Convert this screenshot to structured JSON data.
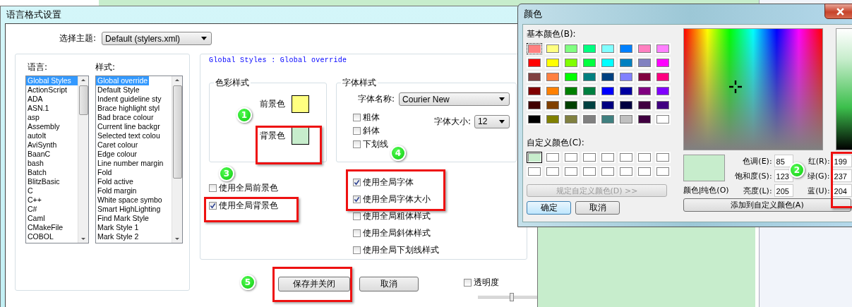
{
  "main_dialog": {
    "title": "语言格式设置",
    "theme": {
      "label": "选择主题:",
      "value": "Default (stylers.xml)"
    },
    "languages": {
      "label": "语言:",
      "items": [
        {
          "text": "Global Styles",
          "selected": true
        },
        {
          "text": "ActionScript",
          "selected": false
        },
        {
          "text": "ADA",
          "selected": false
        },
        {
          "text": "ASN.1",
          "selected": false
        },
        {
          "text": "asp",
          "selected": false
        },
        {
          "text": "Assembly",
          "selected": false
        },
        {
          "text": "autoIt",
          "selected": false
        },
        {
          "text": "AviSynth",
          "selected": false
        },
        {
          "text": "BaanC",
          "selected": false
        },
        {
          "text": "bash",
          "selected": false
        },
        {
          "text": "Batch",
          "selected": false
        },
        {
          "text": "BlitzBasic",
          "selected": false
        },
        {
          "text": "C",
          "selected": false
        },
        {
          "text": "C++",
          "selected": false
        },
        {
          "text": "C#",
          "selected": false
        },
        {
          "text": "Caml",
          "selected": false
        },
        {
          "text": "CMakeFile",
          "selected": false
        },
        {
          "text": "COBOL",
          "selected": false
        }
      ]
    },
    "styles": {
      "label": "样式:",
      "items": [
        {
          "text": "Global override",
          "selected": true
        },
        {
          "text": "Default Style",
          "selected": false
        },
        {
          "text": "Indent guideline sty",
          "selected": false
        },
        {
          "text": "Brace highlight styl",
          "selected": false
        },
        {
          "text": "Bad brace colour",
          "selected": false
        },
        {
          "text": "Current line backgr",
          "selected": false
        },
        {
          "text": "Selected text colou",
          "selected": false
        },
        {
          "text": "Caret colour",
          "selected": false
        },
        {
          "text": "Edge colour",
          "selected": false
        },
        {
          "text": "Line number margin",
          "selected": false
        },
        {
          "text": "Fold",
          "selected": false
        },
        {
          "text": "Fold active",
          "selected": false
        },
        {
          "text": "Fold margin",
          "selected": false
        },
        {
          "text": "White space symbo",
          "selected": false
        },
        {
          "text": "Smart HighLighting",
          "selected": false
        },
        {
          "text": "Find Mark Style",
          "selected": false
        },
        {
          "text": "Mark Style 1",
          "selected": false
        },
        {
          "text": "Mark Style 2",
          "selected": false
        }
      ]
    },
    "style_heading": "Global Styles : Global override",
    "color_style": {
      "title": "色彩样式",
      "swatches": [
        {
          "label": "前景色",
          "color": "#ffff80"
        },
        {
          "label": "背景色",
          "color": "#c7edcc"
        }
      ]
    },
    "font_style": {
      "title": "字体样式",
      "font_name": {
        "label": "字体名称:",
        "value": "Courier New"
      },
      "options": [
        {
          "label": "粗体",
          "checked": false
        },
        {
          "label": "斜体",
          "checked": false
        },
        {
          "label": "下划线",
          "checked": false
        }
      ],
      "font_size": {
        "label": "字体大小:",
        "value": "12"
      }
    },
    "global_color_options": [
      {
        "label": "使用全局前景色",
        "checked": false
      },
      {
        "label": "使用全局背景色",
        "checked": true
      }
    ],
    "global_font_options": [
      {
        "label": "使用全局字体",
        "checked": true
      },
      {
        "label": "使用全局字体大小",
        "checked": true
      },
      {
        "label": "使用全局粗体样式",
        "checked": false
      },
      {
        "label": "使用全局斜体样式",
        "checked": false
      },
      {
        "label": "使用全局下划线样式",
        "checked": false
      }
    ],
    "buttons": [
      {
        "label": "保存并关闭"
      },
      {
        "label": "取消"
      }
    ],
    "transparency": {
      "label": "透明度",
      "checked": false,
      "level": 0.57
    }
  },
  "color_dialog": {
    "title": "颜色",
    "basic_colors_label": "基本颜色(B):",
    "basic_colors": [
      {
        "color": "#ff8080",
        "selected": true
      },
      {
        "color": "#ffff80",
        "selected": false
      },
      {
        "color": "#80ff80",
        "selected": false
      },
      {
        "color": "#00ff80",
        "selected": false
      },
      {
        "color": "#80ffff",
        "selected": false
      },
      {
        "color": "#0080ff",
        "selected": false
      },
      {
        "color": "#ff80c0",
        "selected": false
      },
      {
        "color": "#ff80ff",
        "selected": false
      },
      {
        "color": "#ff0000",
        "selected": false
      },
      {
        "color": "#ffff00",
        "selected": false
      },
      {
        "color": "#80ff00",
        "selected": false
      },
      {
        "color": "#00ff40",
        "selected": false
      },
      {
        "color": "#00ffff",
        "selected": false
      },
      {
        "color": "#0080c0",
        "selected": false
      },
      {
        "color": "#8080c0",
        "selected": false
      },
      {
        "color": "#ff00ff",
        "selected": false
      },
      {
        "color": "#804040",
        "selected": false
      },
      {
        "color": "#ff8040",
        "selected": false
      },
      {
        "color": "#00ff00",
        "selected": false
      },
      {
        "color": "#008080",
        "selected": false
      },
      {
        "color": "#004080",
        "selected": false
      },
      {
        "color": "#8080ff",
        "selected": false
      },
      {
        "color": "#800040",
        "selected": false
      },
      {
        "color": "#ff0080",
        "selected": false
      },
      {
        "color": "#800000",
        "selected": false
      },
      {
        "color": "#ff8000",
        "selected": false
      },
      {
        "color": "#008000",
        "selected": false
      },
      {
        "color": "#008040",
        "selected": false
      },
      {
        "color": "#0000ff",
        "selected": false
      },
      {
        "color": "#0000a0",
        "selected": false
      },
      {
        "color": "#800080",
        "selected": false
      },
      {
        "color": "#8000ff",
        "selected": false
      },
      {
        "color": "#400000",
        "selected": false
      },
      {
        "color": "#804000",
        "selected": false
      },
      {
        "color": "#004000",
        "selected": false
      },
      {
        "color": "#004040",
        "selected": false
      },
      {
        "color": "#000080",
        "selected": false
      },
      {
        "color": "#000040",
        "selected": false
      },
      {
        "color": "#400040",
        "selected": false
      },
      {
        "color": "#400080",
        "selected": false
      },
      {
        "color": "#000000",
        "selected": false
      },
      {
        "color": "#808000",
        "selected": false
      },
      {
        "color": "#808040",
        "selected": false
      },
      {
        "color": "#808080",
        "selected": false
      },
      {
        "color": "#408080",
        "selected": false
      },
      {
        "color": "#c0c0c0",
        "selected": false
      },
      {
        "color": "#400040",
        "selected": false
      },
      {
        "color": "#ffffff",
        "selected": false
      }
    ],
    "custom_colors_label": "自定义颜色(C):",
    "custom_colors": [
      {
        "color": "#c7edcc",
        "selected": true
      },
      {
        "color": "#ffffff",
        "selected": false
      },
      {
        "color": "#ffffff",
        "selected": false
      },
      {
        "color": "#ffffff",
        "selected": false
      },
      {
        "color": "#ffffff",
        "selected": false
      },
      {
        "color": "#ffffff",
        "selected": false
      },
      {
        "color": "#ffffff",
        "selected": false
      },
      {
        "color": "#ffffff",
        "selected": false
      },
      {
        "color": "#ffffff",
        "selected": false
      },
      {
        "color": "#ffffff",
        "selected": false
      },
      {
        "color": "#ffffff",
        "selected": false
      },
      {
        "color": "#ffffff",
        "selected": false
      },
      {
        "color": "#ffffff",
        "selected": false
      },
      {
        "color": "#ffffff",
        "selected": false
      },
      {
        "color": "#ffffff",
        "selected": false
      },
      {
        "color": "#ffffff",
        "selected": false
      }
    ],
    "define_button": {
      "label": "规定自定义颜色(D) >>",
      "disabled": true
    },
    "ok_button": "确定",
    "cancel_button": "取消",
    "preview": {
      "label": "颜色|纯色(O)",
      "color": "#c7edcc"
    },
    "hsl_fields": [
      {
        "label": "色调(E):",
        "value": "85"
      },
      {
        "label": "饱和度(S):",
        "value": "123"
      },
      {
        "label": "亮度(L):",
        "value": "205"
      }
    ],
    "rgb_fields": [
      {
        "label": "红(R):",
        "value": "199"
      },
      {
        "label": "绿(G):",
        "value": "237"
      },
      {
        "label": "蓝(U):",
        "value": "204"
      }
    ],
    "add_button": "添加到自定义颜色(A)"
  },
  "annotations": [
    {
      "text": "1"
    },
    {
      "text": "2"
    },
    {
      "text": "3"
    },
    {
      "text": "4"
    },
    {
      "text": "5"
    }
  ]
}
